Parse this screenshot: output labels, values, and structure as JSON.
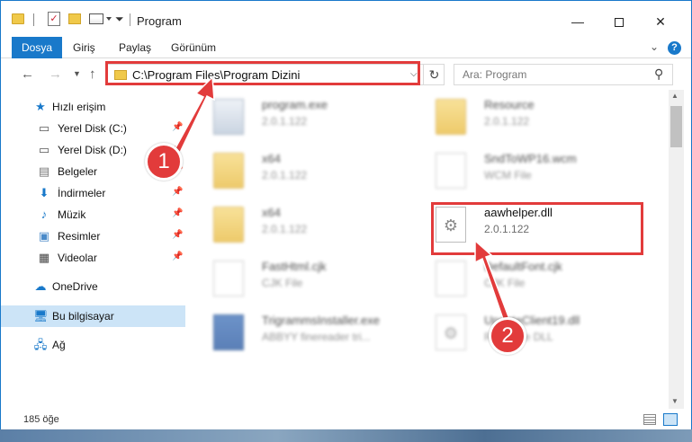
{
  "window": {
    "title": "Program"
  },
  "ribbon": {
    "tabs": [
      {
        "label": "Dosya"
      },
      {
        "label": "Giriş"
      },
      {
        "label": "Paylaş"
      },
      {
        "label": "Görünüm"
      }
    ]
  },
  "nav": {
    "address": "C:\\Program Files\\Program Dizini",
    "search_placeholder": "Ara: Program"
  },
  "sidebar": {
    "items": [
      {
        "label": "Hızlı erişim",
        "icon": "star-icon"
      },
      {
        "label": "Yerel Disk (C:)",
        "icon": "drive-icon",
        "pinned": true
      },
      {
        "label": "Yerel Disk (D:)",
        "icon": "drive-icon",
        "pinned": true
      },
      {
        "label": "Belgeler",
        "icon": "documents-icon",
        "pinned": true
      },
      {
        "label": "İndirmeler",
        "icon": "download-icon",
        "pinned": true
      },
      {
        "label": "Müzik",
        "icon": "music-icon",
        "pinned": true
      },
      {
        "label": "Resimler",
        "icon": "pictures-icon",
        "pinned": true
      },
      {
        "label": "Videolar",
        "icon": "video-icon",
        "pinned": true
      },
      {
        "label": "OneDrive",
        "icon": "cloud-icon"
      },
      {
        "label": "Bu bilgisayar",
        "icon": "computer-icon",
        "selected": true
      },
      {
        "label": "Ağ",
        "icon": "network-icon"
      }
    ]
  },
  "files": [
    {
      "name": "program.exe",
      "sub": "2.0.1.122",
      "icon": "exe",
      "blurred": true
    },
    {
      "name": "Resource",
      "sub": "2.0.1.122",
      "icon": "folder",
      "blurred": true
    },
    {
      "name": "x64",
      "sub": "2.0.1.122",
      "icon": "folder",
      "blurred": true
    },
    {
      "name": "SndToWP16.wcm",
      "sub": "WCM File",
      "icon": "doc",
      "blurred": true
    },
    {
      "name": "x64",
      "sub": "2.0.1.122",
      "icon": "folder",
      "blurred": true
    },
    {
      "name": "aawhelper.dll",
      "sub": "2.0.1.122",
      "icon": "dll",
      "blurred": false
    },
    {
      "name": "FastHtml.cjk",
      "sub": "CJK File",
      "icon": "doc",
      "blurred": true
    },
    {
      "name": "DefaultFont.cjk",
      "sub": "CJK File",
      "icon": "doc",
      "blurred": true
    },
    {
      "name": "TrigrammsInstaller.exe",
      "sub": "ABBYY finereader tri...",
      "icon": "exe2",
      "blurred": true
    },
    {
      "name": "UpdateClient19.dll",
      "sub": "Resource DLL",
      "icon": "dll",
      "blurred": true
    }
  ],
  "status": {
    "item_count": "185 öğe"
  },
  "callouts": [
    "1",
    "2"
  ],
  "colors": {
    "accent": "#1979ca",
    "highlight": "#e23b3b",
    "selected_bg": "#cce4f7"
  }
}
